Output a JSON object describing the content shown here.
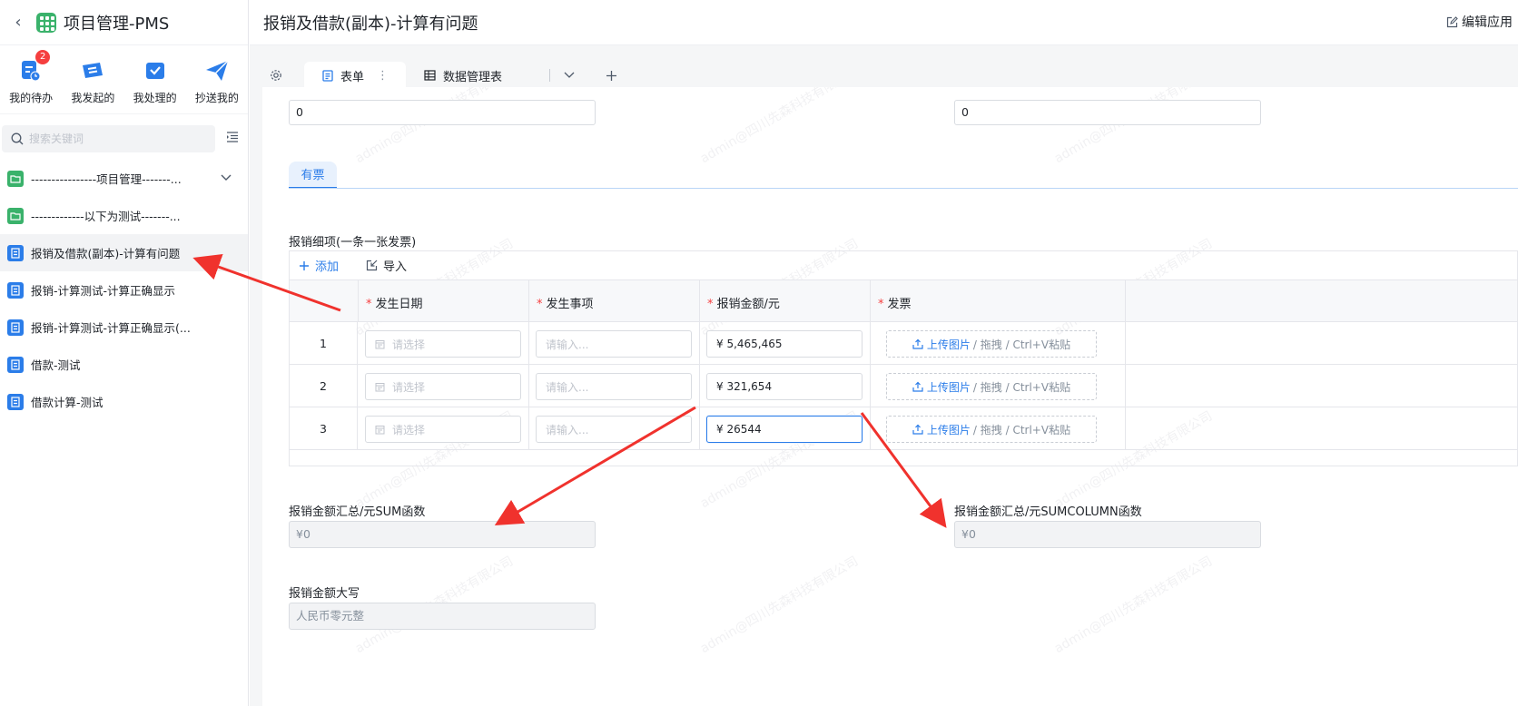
{
  "sidebar": {
    "app_title": "项目管理-PMS",
    "quick": [
      {
        "label": "我的待办",
        "badge": "2"
      },
      {
        "label": "我发起的"
      },
      {
        "label": "我处理的"
      },
      {
        "label": "抄送我的"
      }
    ],
    "search_placeholder": "搜索关键词",
    "items": [
      {
        "label": "----------------项目管理-------..."
      },
      {
        "label": "-------------以下为测试-------..."
      },
      {
        "label": "报销及借款(副本)-计算有问题"
      },
      {
        "label": "报销-计算测试-计算正确显示"
      },
      {
        "label": "报销-计算测试-计算正确显示(..."
      },
      {
        "label": "借款-测试"
      },
      {
        "label": "借款计算-测试"
      }
    ]
  },
  "header": {
    "title": "报销及借款(副本)-计算有问题",
    "edit_label": "编辑应用"
  },
  "tabs": {
    "form_label": "表单",
    "data_label": "数据管理表"
  },
  "form": {
    "top_left_value": "0",
    "top_right_value": "0",
    "sub_tab": "有票",
    "detail_title": "报销细项(一条一张发票)",
    "add_label": "添加",
    "import_label": "导入",
    "columns": [
      "发生日期",
      "发生事项",
      "报销金额/元",
      "发票"
    ],
    "rows": [
      {
        "no": "1",
        "date_placeholder": "请选择",
        "item_placeholder": "请输入...",
        "amount": "¥  5,465,465"
      },
      {
        "no": "2",
        "date_placeholder": "请选择",
        "item_placeholder": "请输入...",
        "amount": "¥  321,654"
      },
      {
        "no": "3",
        "date_placeholder": "请选择",
        "item_placeholder": "请输入...",
        "amount": "¥  26544"
      }
    ],
    "upload_link": "上传图片",
    "upload_hint": "/ 拖拽 / Ctrl+V粘贴",
    "sum_label": "报销金额汇总/元SUM函数",
    "sum_value": "¥0",
    "sumcol_label": "报销金额汇总/元SUMCOLUMN函数",
    "sumcol_value": "¥0",
    "upper_label": "报销金额大写",
    "upper_value": "人民币零元整"
  },
  "watermark_text": "admin@四川先森科技有限公司",
  "colors": {
    "accent": "#2b7de9",
    "app_green": "#3ab26b",
    "arrow": "#f0322d"
  }
}
